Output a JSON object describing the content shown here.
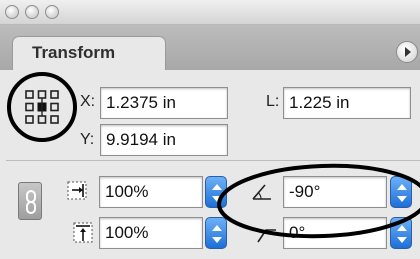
{
  "panel": {
    "tab_label": "Transform"
  },
  "fields": {
    "x": {
      "label": "X:",
      "value": "1.2375 in"
    },
    "y": {
      "label": "Y:",
      "value": "9.9194 in"
    },
    "l": {
      "label": "L:",
      "value": "1.225 in"
    },
    "scale_x": {
      "value": "100%"
    },
    "scale_y": {
      "value": "100%"
    },
    "rotate": {
      "value": "-90°"
    },
    "shear": {
      "value": "0°"
    }
  },
  "icons": {
    "reference_point": "reference-point-grid-icon",
    "constrain": "chain-link-icon",
    "scale_x": "scale-horizontal-icon",
    "scale_y": "scale-vertical-icon",
    "rotate": "rotate-angle-icon",
    "shear": "shear-angle-icon",
    "menu": "panel-menu-arrow-icon"
  },
  "colors": {
    "stepper": "#2f7ae5",
    "annotation": "#000000"
  }
}
